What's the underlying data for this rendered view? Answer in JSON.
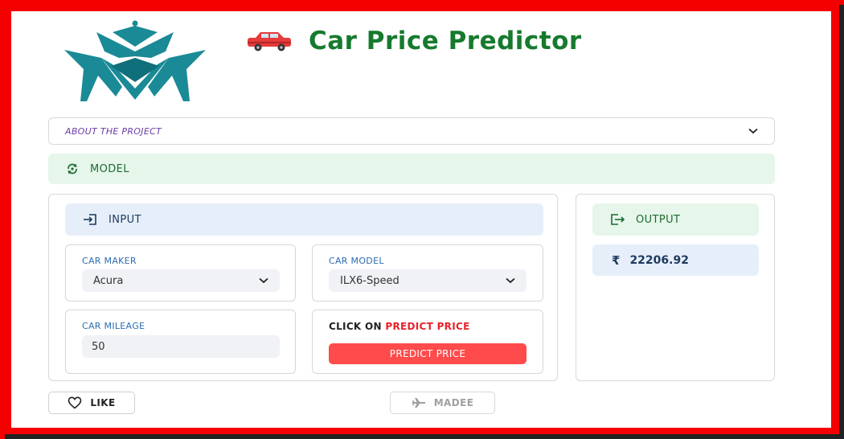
{
  "app": {
    "title": "Car Price Predictor",
    "title_icon": "car-icon",
    "logo": "crown-m-logo"
  },
  "expander": {
    "label": "ABOUT THE PROJECT",
    "icon": "chevron-down-icon"
  },
  "model_section": {
    "label": "MODEL",
    "icon": "sync-icon"
  },
  "input_section": {
    "label": "INPUT",
    "icon": "input-icon",
    "car_maker": {
      "label": "CAR MAKER",
      "value": "Acura"
    },
    "car_model": {
      "label": "CAR MODEL",
      "value": "ILX6-Speed"
    },
    "car_mileage": {
      "label": "CAR MILEAGE",
      "value": "50"
    },
    "predict": {
      "caption_prefix": "CLICK ON",
      "caption_highlight": "PREDICT PRICE",
      "button_label": "PREDICT PRICE"
    }
  },
  "output_section": {
    "label": "OUTPUT",
    "icon": "output-icon",
    "currency_symbol": "₹",
    "value": "22206.92"
  },
  "footer": {
    "like_label": "LIKE",
    "like_icon": "heart-icon",
    "madee_label": "MADEE",
    "madee_icon": "airplane-icon"
  },
  "colors": {
    "frame": "#f40000",
    "title": "#167a2e",
    "logo": "#1a8a96",
    "primary_button": "#ff4b4b",
    "success_bg": "#e6f6ea",
    "info_bg": "#e6eff9"
  }
}
